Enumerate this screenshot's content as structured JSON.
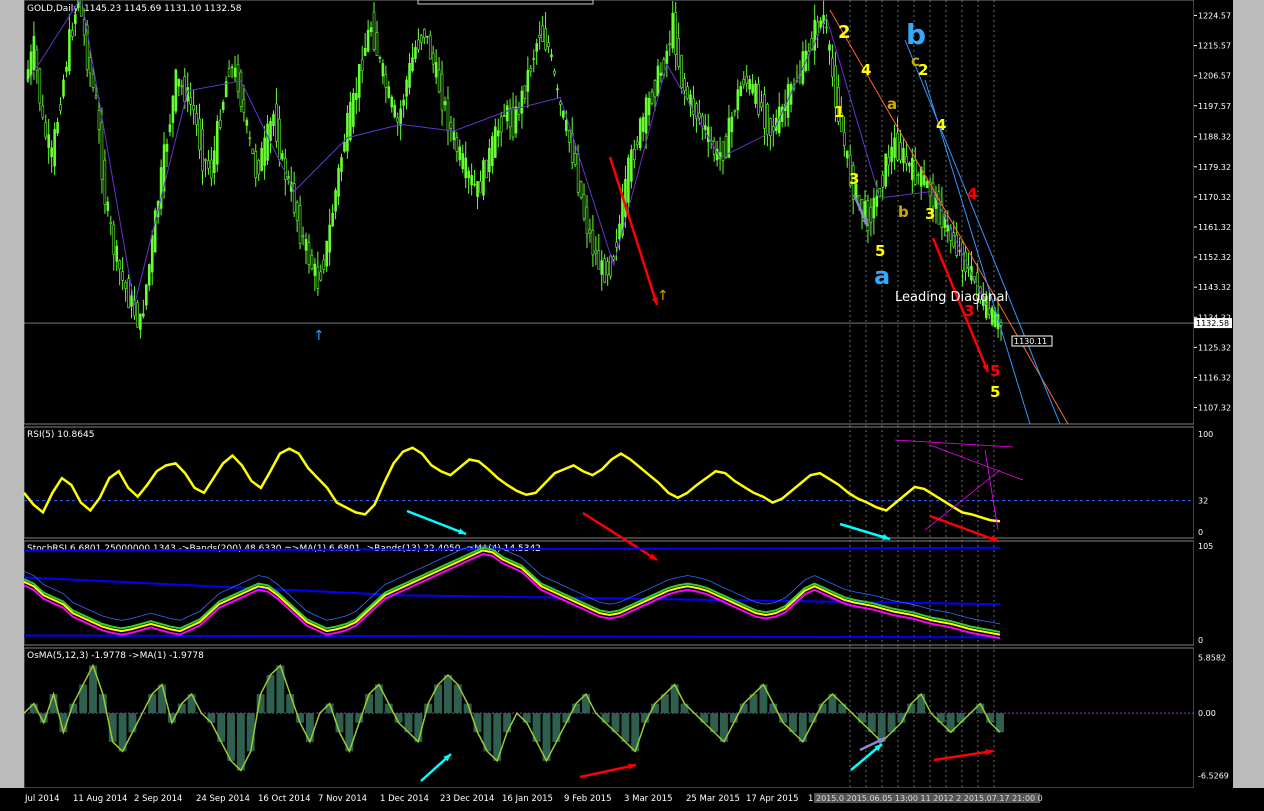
{
  "window": {
    "symbol_label": "GOLD,Daily",
    "ohlc_label": "1145.23 1145.69 1131.10 1132.58"
  },
  "colors": {
    "background": "#000000",
    "frame": "#7f7f7f",
    "candle": "#66ff33",
    "rsi_line": "#ffff00",
    "blue_band": "#0000ff",
    "magenta": "#ff00ff",
    "hist_fill": "#2f5f4f",
    "hist_line": "#99cc33",
    "axis_text": "#ffffff",
    "red_arrow": "#ff0000",
    "cyan_arrow": "#00ffff",
    "wave_yellow": "#ffff00",
    "wave_blue": "#33aaff",
    "wave_red": "#ff0000"
  },
  "chart_data": [
    {
      "type": "candlestick",
      "name": "main",
      "title": "GOLD,Daily",
      "ylim": [
        1103,
        1228
      ],
      "y_ticks": [
        "1224.57",
        "1215.57",
        "1206.57",
        "1197.57",
        "1188.32",
        "1179.32",
        "1170.32",
        "1161.32",
        "1152.32",
        "1143.32",
        "1134.32",
        "1125.32",
        "1116.32",
        "1107.32"
      ],
      "last_price": "1132.58",
      "price_tag": "1130.11",
      "price_series": [
        1205,
        1215,
        1192,
        1182,
        1200,
        1217,
        1230,
        1212,
        1198,
        1170,
        1155,
        1145,
        1138,
        1132,
        1150,
        1170,
        1188,
        1205,
        1202,
        1196,
        1182,
        1178,
        1195,
        1210,
        1205,
        1190,
        1178,
        1185,
        1195,
        1180,
        1172,
        1160,
        1152,
        1145,
        1155,
        1172,
        1188,
        1198,
        1212,
        1222,
        1210,
        1200,
        1192,
        1205,
        1215,
        1220,
        1210,
        1200,
        1190,
        1182,
        1176,
        1172,
        1180,
        1188,
        1196,
        1192,
        1200,
        1210,
        1220,
        1215,
        1200,
        1190,
        1180,
        1165,
        1155,
        1148,
        1150,
        1162,
        1178,
        1188,
        1196,
        1204,
        1210,
        1222,
        1205,
        1198,
        1194,
        1188,
        1182,
        1186,
        1198,
        1206,
        1202,
        1197,
        1190,
        1194,
        1200,
        1206,
        1212,
        1220,
        1224,
        1206,
        1190,
        1176,
        1168,
        1164,
        1170,
        1180,
        1186,
        1182,
        1178,
        1176,
        1172,
        1166,
        1160,
        1155,
        1150,
        1145,
        1138,
        1134,
        1132
      ],
      "annotations": [
        {
          "text": "2",
          "color": "#ffff00"
        },
        {
          "text": "4",
          "color": "#ffff00"
        },
        {
          "text": "1",
          "color": "#ffff00"
        },
        {
          "text": "3",
          "color": "#ffff00"
        },
        {
          "text": "5",
          "color": "#ffff00"
        },
        {
          "text": "a",
          "color": "#33aaff"
        },
        {
          "text": "b",
          "color": "#33aaff"
        },
        {
          "text": "c",
          "color": "#ccaa00"
        },
        {
          "text": "2",
          "color": "#ffff00"
        },
        {
          "text": "a",
          "color": "#ccaa00"
        },
        {
          "text": "b",
          "color": "#ccaa00"
        },
        {
          "text": "4",
          "color": "#ffff00"
        },
        {
          "text": "3",
          "color": "#ffff00"
        },
        {
          "text": "4",
          "color": "#ff0000"
        },
        {
          "text": "3",
          "color": "#ff0000"
        },
        {
          "text": "5",
          "color": "#ff0000"
        },
        {
          "text": "5",
          "color": "#ffff00"
        },
        {
          "text": "Leading Diagonal",
          "color": "#ffffff"
        }
      ]
    },
    {
      "type": "line",
      "name": "rsi",
      "label": "RSI(5) 10.8645",
      "ylim": [
        0,
        100
      ],
      "y_ticks": [
        "100",
        "32",
        "0"
      ],
      "level": 32,
      "values": [
        40,
        28,
        20,
        40,
        55,
        48,
        30,
        22,
        35,
        55,
        62,
        45,
        36,
        48,
        62,
        68,
        70,
        60,
        45,
        40,
        55,
        70,
        78,
        68,
        52,
        45,
        62,
        80,
        85,
        80,
        65,
        55,
        45,
        30,
        25,
        20,
        18,
        28,
        50,
        70,
        82,
        86,
        80,
        68,
        62,
        58,
        66,
        74,
        72,
        64,
        55,
        48,
        42,
        38,
        40,
        50,
        60,
        64,
        68,
        62,
        58,
        64,
        74,
        80,
        74,
        66,
        58,
        50,
        40,
        35,
        40,
        48,
        55,
        62,
        60,
        52,
        46,
        40,
        36,
        30,
        34,
        42,
        50,
        58,
        60,
        54,
        48,
        40,
        34,
        30,
        25,
        22,
        30,
        38,
        46,
        44,
        38,
        32,
        26,
        20,
        18,
        15,
        12,
        11
      ]
    },
    {
      "type": "line",
      "name": "stochrsi",
      "label": "StochRSI 6.6801 25000000.1343 ->Bands(200) 48.6330 =>MA(1) 6.6801 ->Bands(13) 22.4050 ->MA(4) 14.5342",
      "ylim": [
        0,
        105
      ],
      "y_ticks": [
        "105",
        "0"
      ],
      "values": [
        65,
        60,
        50,
        45,
        40,
        30,
        25,
        20,
        15,
        12,
        10,
        12,
        15,
        18,
        15,
        12,
        10,
        15,
        20,
        30,
        40,
        45,
        50,
        55,
        60,
        58,
        50,
        40,
        30,
        20,
        15,
        10,
        12,
        15,
        20,
        30,
        40,
        50,
        55,
        60,
        65,
        70,
        75,
        80,
        85,
        90,
        95,
        100,
        98,
        90,
        85,
        80,
        70,
        60,
        55,
        50,
        45,
        40,
        35,
        30,
        28,
        30,
        35,
        40,
        45,
        50,
        55,
        58,
        60,
        58,
        55,
        50,
        45,
        40,
        35,
        30,
        28,
        30,
        35,
        45,
        55,
        60,
        55,
        50,
        45,
        42,
        40,
        38,
        35,
        32,
        30,
        28,
        25,
        22,
        20,
        18,
        15,
        12,
        10,
        8,
        6
      ]
    },
    {
      "type": "area",
      "name": "histogram",
      "label": "OsMA(5,12,3) -1.9778 ->MA(1) -1.9778",
      "ylim": [
        -7,
        6.2
      ],
      "y_ticks": [
        "5.8582",
        "0.00",
        "-6.5269"
      ],
      "values": [
        0,
        1,
        -1,
        2,
        -2,
        1,
        3,
        5,
        2,
        -3,
        -4,
        -2,
        0,
        2,
        3,
        -1,
        1,
        2,
        0,
        -1,
        -3,
        -5,
        -6,
        -4,
        2,
        4,
        5,
        2,
        -1,
        -3,
        0,
        1,
        -2,
        -4,
        -1,
        2,
        3,
        1,
        -1,
        -2,
        -3,
        1,
        3,
        4,
        3,
        1,
        -2,
        -4,
        -5,
        -2,
        0,
        -1,
        -3,
        -5,
        -3,
        -1,
        1,
        2,
        0,
        -1,
        -2,
        -3,
        -4,
        -1,
        1,
        2,
        3,
        1,
        0,
        -1,
        -2,
        -3,
        -1,
        1,
        2,
        3,
        1,
        -1,
        -2,
        -3,
        -1,
        1,
        2,
        1,
        0,
        -1,
        -2,
        -3,
        -2,
        -1,
        1,
        2,
        0,
        -1,
        -2,
        -1,
        0,
        1,
        -1,
        -2
      ]
    }
  ],
  "x_axis_labels": [
    "Jul 2014",
    "11 Aug 2014",
    "2 Sep 2014",
    "24 Sep 2014",
    "16 Oct 2014",
    "7 Nov 2014",
    "1 Dec 2014",
    "23 Dec 2014",
    "16 Jan 2015",
    "9 Feb 2015",
    "3 Mar 2015",
    "25 Mar 2015",
    "17 Apr 2015",
    "1"
  ],
  "time_box": "2015.0 2015.06.05 13:00 11 2012 2 2015.07.17 21:00 0"
}
